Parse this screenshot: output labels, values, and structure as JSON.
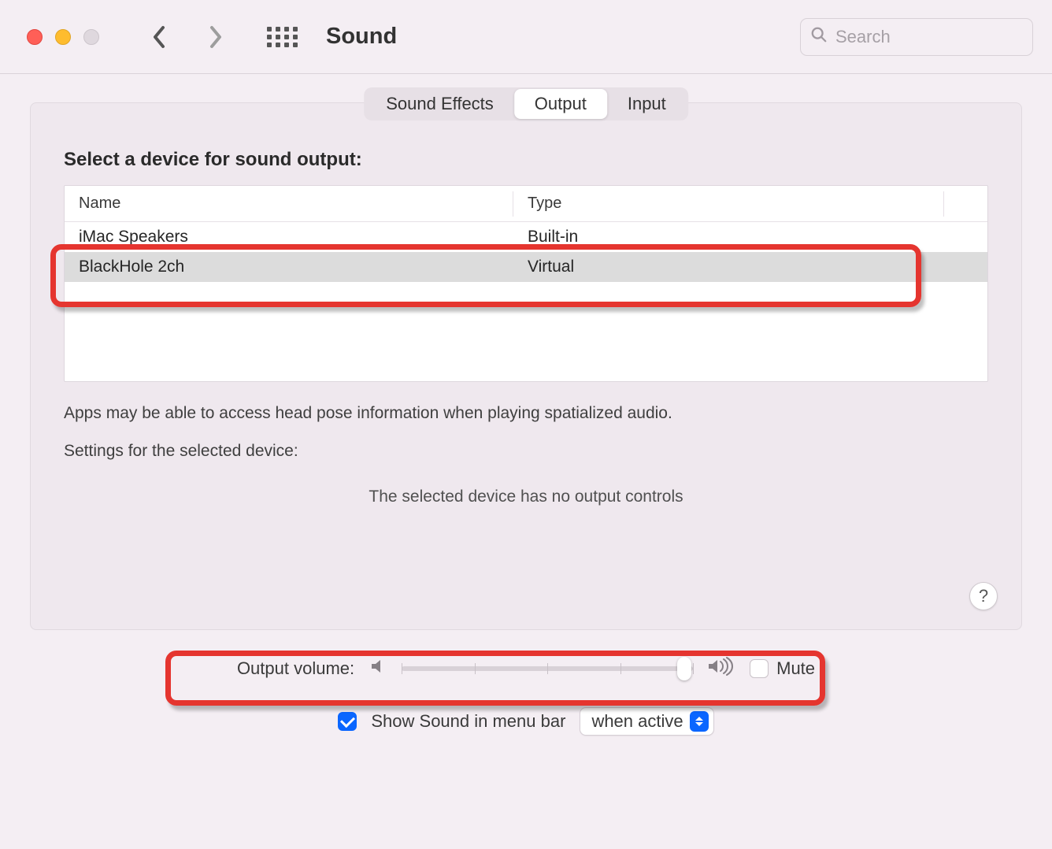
{
  "window": {
    "title": "Sound"
  },
  "search": {
    "placeholder": "Search",
    "value": ""
  },
  "tabs": {
    "items": [
      {
        "label": "Sound Effects",
        "active": false
      },
      {
        "label": "Output",
        "active": true
      },
      {
        "label": "Input",
        "active": false
      }
    ]
  },
  "section": {
    "heading": "Select a device for sound output:",
    "columns": {
      "name": "Name",
      "type": "Type"
    },
    "devices": [
      {
        "name": "iMac Speakers",
        "type": "Built-in",
        "selected": false
      },
      {
        "name": "BlackHole 2ch",
        "type": "Virtual",
        "selected": true
      }
    ],
    "info_text": "Apps may be able to access head pose information when playing spatialized audio.",
    "settings_label": "Settings for the selected device:",
    "no_controls_text": "The selected device has no output controls",
    "help_label": "?"
  },
  "volume": {
    "label": "Output volume:",
    "value_percent": 97,
    "mute_label": "Mute",
    "mute_checked": false
  },
  "menubar": {
    "show_label": "Show Sound in menu bar",
    "show_checked": true,
    "dropdown_value": "when active"
  }
}
